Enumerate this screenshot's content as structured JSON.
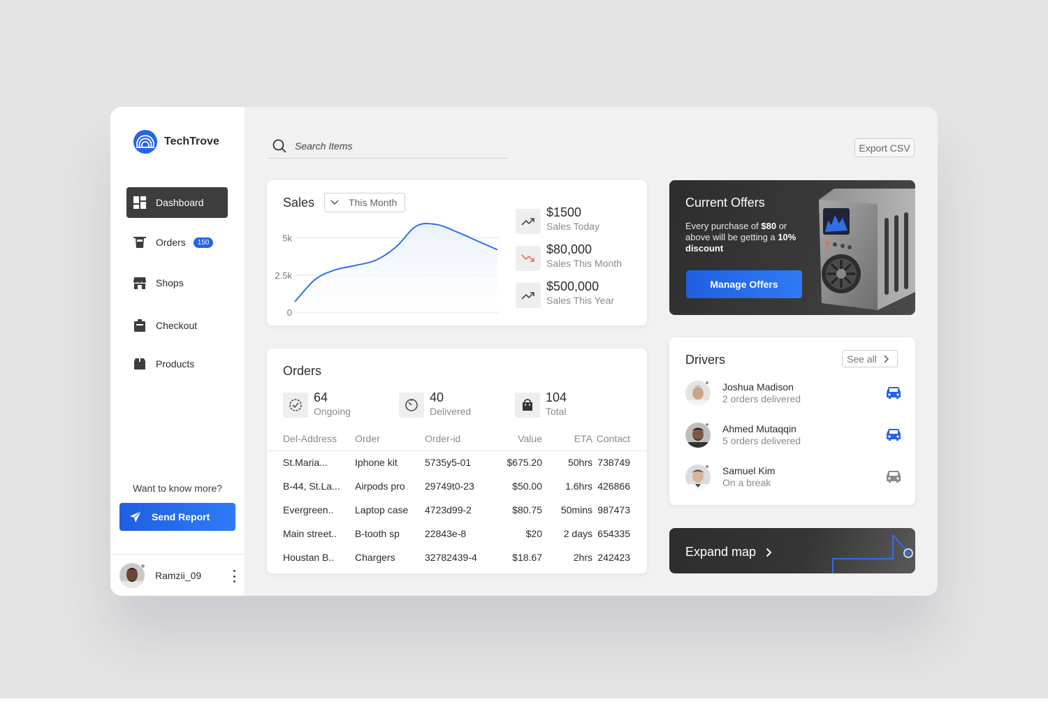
{
  "app": {
    "name": "TechTrove"
  },
  "sidebar": {
    "items": [
      {
        "label": "Dashboard",
        "icon": "dashboard-icon",
        "active": true
      },
      {
        "label": "Orders",
        "icon": "basket-icon",
        "badge": "150"
      },
      {
        "label": "Shops",
        "icon": "shop-icon"
      },
      {
        "label": "Checkout",
        "icon": "checkout-icon"
      },
      {
        "label": "Products",
        "icon": "box-icon"
      }
    ],
    "know_more": "Want to know more?",
    "send_report": "Send Report",
    "user": {
      "name": "Ramzii_09"
    }
  },
  "header": {
    "search_placeholder": "Search Items",
    "export_label": "Export CSV"
  },
  "sales": {
    "title": "Sales",
    "period": "This Month",
    "stats": [
      {
        "value": "$1500",
        "label": "Sales Today",
        "trend": "up"
      },
      {
        "value": "$80,000",
        "label": "Sales This Month",
        "trend": "down"
      },
      {
        "value": "$500,000",
        "label": "Sales This Year",
        "trend": "up"
      }
    ]
  },
  "chart_data": {
    "type": "area",
    "x": [
      0,
      1,
      2,
      3,
      4,
      5,
      6,
      7,
      8,
      9,
      10
    ],
    "values": [
      700,
      2200,
      2850,
      3150,
      3500,
      4400,
      5800,
      5900,
      5400,
      4800,
      4200
    ],
    "yticks": [
      "0",
      "2.5k",
      "5k"
    ],
    "ylim": [
      0,
      5000
    ],
    "grid": true,
    "colors": {
      "line": "#2f6fe6",
      "fill": "#eaf0fb"
    }
  },
  "orders": {
    "title": "Orders",
    "stats": [
      {
        "value": "64",
        "label": "Ongoing"
      },
      {
        "value": "40",
        "label": "Delivered"
      },
      {
        "value": "104",
        "label": "Total"
      }
    ],
    "columns": [
      "Del-Address",
      "Order",
      "Order-id",
      "Value",
      "ETA",
      "Contact"
    ],
    "rows": [
      [
        "St.Maria...",
        "Iphone kit",
        "5735y5-01",
        "$675.20",
        "50hrs",
        "738749"
      ],
      [
        "B-44, St.La...",
        "Airpods pro",
        "29749t0-23",
        "$50.00",
        "1.6hrs",
        "426866"
      ],
      [
        "Evergreen..",
        "Laptop case",
        "4723d99-2",
        "$80.75",
        "50mins",
        "987473"
      ],
      [
        "Main street..",
        "B-tooth sp",
        "22843e-8",
        "$20",
        "2 days",
        "654335"
      ],
      [
        "Houstan B..",
        "Chargers",
        "32782439-4",
        "$18.67",
        "2hrs",
        "242423"
      ]
    ]
  },
  "offers": {
    "title": "Current Offers",
    "text_1": "Every purchase of ",
    "amount": "$80",
    "text_2": " or above will be getting a ",
    "discount": "10% discount",
    "button": "Manage Offers"
  },
  "drivers": {
    "title": "Drivers",
    "see_all": "See all",
    "list": [
      {
        "name": "Joshua Madison",
        "status": "2 orders delivered",
        "car_color": "#2563eb"
      },
      {
        "name": "Ahmed Mutaqqin",
        "status": "5 orders delivered",
        "car_color": "#2563eb"
      },
      {
        "name": "Samuel Kim",
        "status": "On a break",
        "car_color": "#8a8a8a"
      }
    ]
  },
  "map": {
    "label": "Expand map"
  }
}
